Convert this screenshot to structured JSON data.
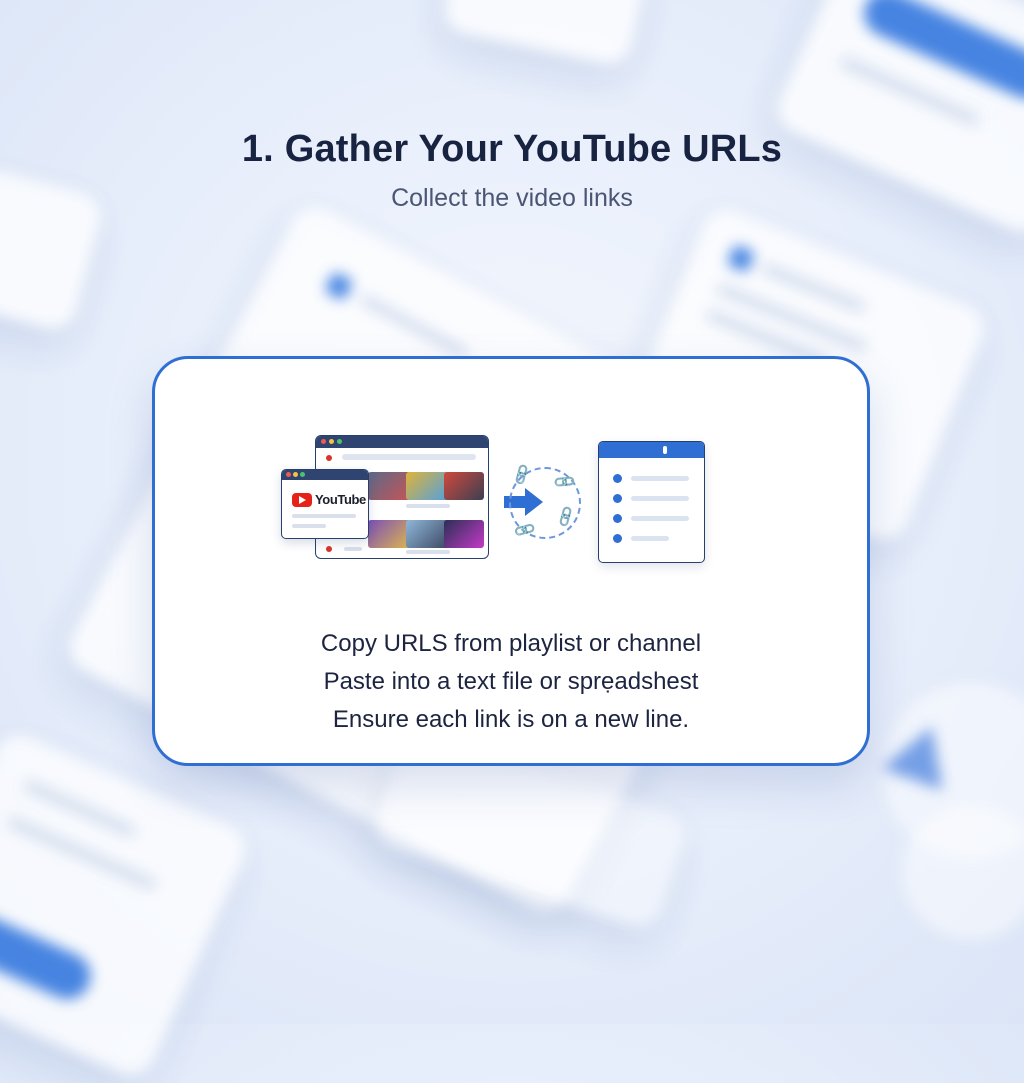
{
  "header": {
    "title": "1. Gather Your YouTube URLs",
    "subtitle": "Collect the video links"
  },
  "illustration": {
    "brand_label": "YouTube",
    "accent_color": "#2f6fd3",
    "youtube_red": "#e62117",
    "icons": [
      "browser-window-icon",
      "youtube-logo-icon",
      "arrow-right-icon",
      "link-chain-icon",
      "list-document-icon"
    ]
  },
  "steps": [
    "Copy URLS from playlist or channel",
    "Paste into a text file or sprẹadshest",
    "Ensure each link is on a new line."
  ]
}
